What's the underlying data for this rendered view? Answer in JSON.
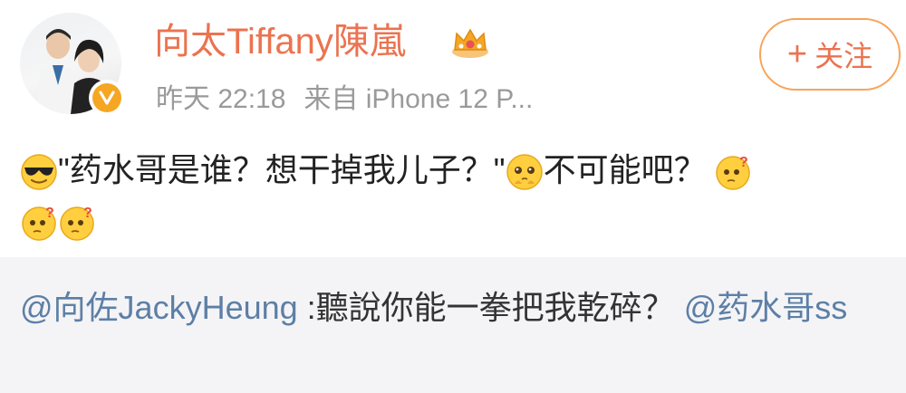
{
  "post": {
    "username": "向太Tiffany陳嵐",
    "time": "昨天 22:18",
    "source": "来自 iPhone 12 P...",
    "follow_label": "关注",
    "follow_icon": "plus-icon",
    "badge": "crown-icon",
    "verified_badge": "verified-v-icon",
    "content": {
      "text_1": "\"药水哥是谁？想干掉我儿子？\"",
      "text_2": "不可能吧？",
      "emojis": [
        "sunglasses-emoji",
        "pleading-emoji",
        "confused-question-emoji",
        "confused-question-emoji",
        "confused-question-emoji"
      ]
    }
  },
  "repost": {
    "mention_1": "@向佐JackyHeung",
    "text": " :聽說你能一拳把我乾碎？",
    "mention_2": "@药水哥ss"
  },
  "colors": {
    "username": "#eb7350",
    "meta": "#9a9a9a",
    "mention": "#5d7fa6",
    "follow_border": "#f7a45a",
    "repost_bg": "#f4f4f6"
  }
}
